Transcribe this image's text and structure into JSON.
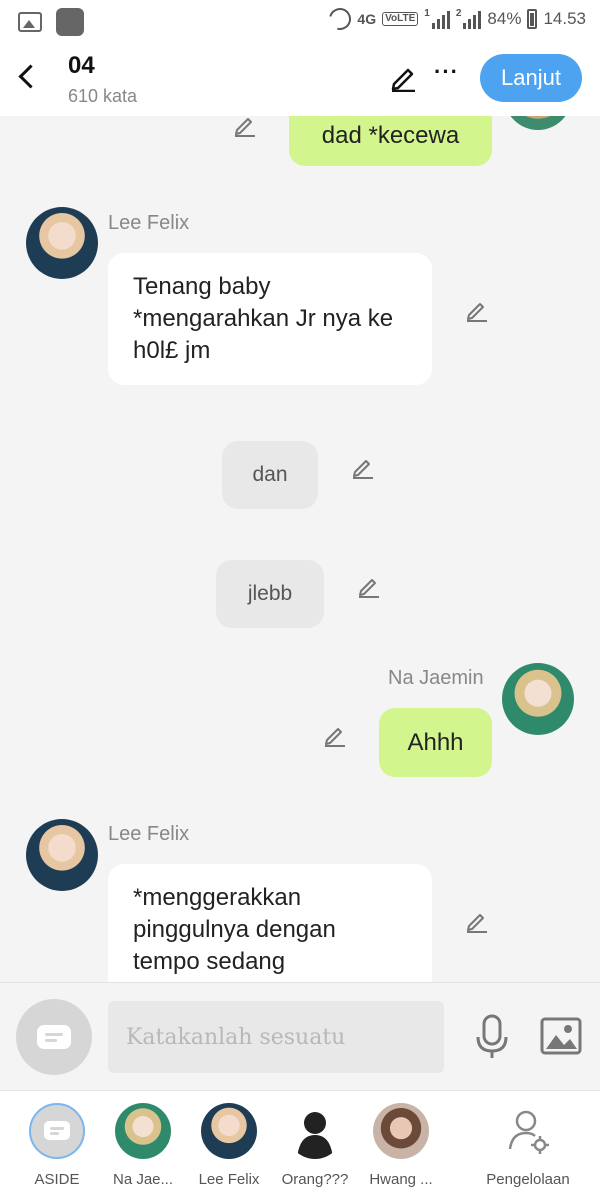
{
  "status_bar": {
    "network": "4G",
    "volte": "VoLTE",
    "sim1": "1",
    "sim2": "2",
    "battery": "84%",
    "time": "14.53"
  },
  "header": {
    "title": "04",
    "subtitle": "610 kata",
    "next_label": "Lanjut"
  },
  "messages": [
    {
      "side": "right",
      "style": "green",
      "text": "dad *kecewa"
    },
    {
      "side": "left",
      "style": "white",
      "sender": "Lee Felix",
      "text": "Tenang baby *mengarahkan Jr nya ke h0l£ jm"
    },
    {
      "side": "center",
      "style": "gray",
      "text": "dan"
    },
    {
      "side": "center",
      "style": "gray",
      "text": "jlebb"
    },
    {
      "side": "right",
      "style": "green",
      "sender": "Na Jaemin",
      "text": "Ahhh"
    },
    {
      "side": "left",
      "style": "white",
      "sender": "Lee Felix",
      "text": "*menggerakkan pinggulnya dengan tempo sedang"
    }
  ],
  "composer": {
    "placeholder": "Katakanlah sesuatu"
  },
  "bottom_nav": [
    {
      "label": "ASIDE",
      "icon": "aside-icon"
    },
    {
      "label": "Na Jae...",
      "icon": "avatar"
    },
    {
      "label": "Lee Felix",
      "icon": "avatar"
    },
    {
      "label": "Orang???",
      "icon": "silhouette"
    },
    {
      "label": "Hwang ...",
      "icon": "avatar"
    },
    {
      "label": "Pengelolaan",
      "icon": "person-gear-icon"
    }
  ],
  "colors": {
    "accent": "#4da3f0",
    "bubble_green": "#d3f58d",
    "bubble_gray": "#e8e8e8",
    "background": "#f4f4f4"
  }
}
